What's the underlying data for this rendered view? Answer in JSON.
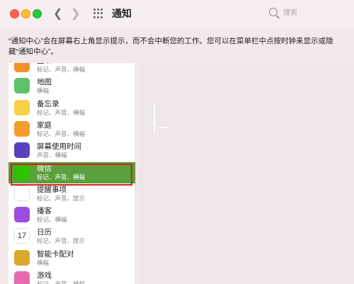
{
  "window": {
    "title": "通知",
    "search_placeholder": "搜索"
  },
  "description": "“通知中心”会在屏幕右上角显示提示，而不会中断您的工作。您可以在菜单栏中点按时钟来显示或隐藏“通知中心”。",
  "apps": [
    {
      "name": "图书",
      "sub": "标记、声音、横幅",
      "icon": "books-icon",
      "color": "#f2902a"
    },
    {
      "name": "地图",
      "sub": "横幅",
      "icon": "maps-icon",
      "color": "#5ec26a"
    },
    {
      "name": "备忘录",
      "sub": "标记、声音、横幅",
      "icon": "notes-icon",
      "color": "#f7d246"
    },
    {
      "name": "家庭",
      "sub": "标记、声音、横幅",
      "icon": "home-icon",
      "color": "#f39c2b"
    },
    {
      "name": "屏幕使用时间",
      "sub": "声音、横幅",
      "icon": "hourglass-icon",
      "color": "#5a3fbf"
    },
    {
      "name": "微信",
      "sub": "标记、声音、横幅",
      "icon": "wechat-icon",
      "color": "#2dc100",
      "selected": true
    },
    {
      "name": "提醒事项",
      "sub": "标记、声音、提示",
      "icon": "reminders-icon",
      "color": "#ffffff"
    },
    {
      "name": "播客",
      "sub": "标记、横幅",
      "icon": "podcasts-icon",
      "color": "#9b4de0"
    },
    {
      "name": "日历",
      "sub": "标记、声音、提示",
      "icon": "calendar-icon",
      "color": "#ffffff"
    },
    {
      "name": "智能卡配对",
      "sub": "横幅",
      "icon": "smartcard-icon",
      "color": "#d9a82e"
    },
    {
      "name": "游戏",
      "sub": "标记、声音、横幅",
      "icon": "game-center-icon",
      "color": "#e86ab0"
    }
  ],
  "calendar_icon_day": "17"
}
